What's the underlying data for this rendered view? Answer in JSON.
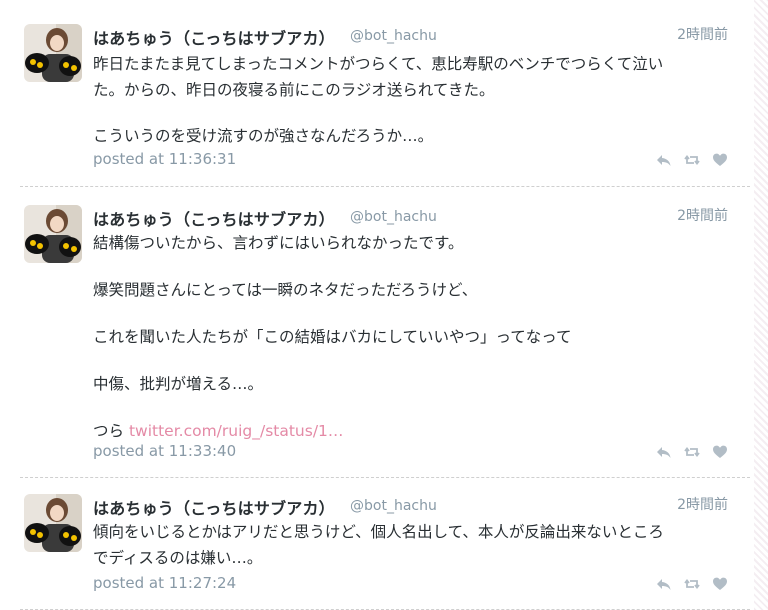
{
  "colors": {
    "text": "#292f33",
    "muted": "#8899a6",
    "link": "#e48aa6",
    "icon": "#b2bdc6"
  },
  "tweets": [
    {
      "display_name": "はあちゅう（こっちはサブアカ）",
      "screen_name": "@bot_hachu",
      "timestamp": "2時間前",
      "lines": [
        "昨日たまたま見てしまったコメントがつらくて、恵比寿駅のベンチでつらくて泣い",
        "た。からの、昨日の夜寝る前にこのラジオ送られてきた。",
        "",
        "こういうのを受け流すのが強さなんだろうか…。"
      ],
      "posted_at": "posted at 11:36:31",
      "actions": [
        "reply-icon",
        "retweet-icon",
        "like-icon"
      ]
    },
    {
      "display_name": "はあちゅう（こっちはサブアカ）",
      "screen_name": "@bot_hachu",
      "timestamp": "2時間前",
      "lines": [
        "結構傷ついたから、言わずにはいられなかったです。",
        "",
        "爆笑問題さんにとっては一瞬のネタだっただろうけど、",
        "",
        "これを聞いた人たちが「この結婚はバカにしていいやつ」ってなって",
        "",
        "中傷、批判が増える…。",
        ""
      ],
      "last_line_prefix": "つら ",
      "link_text": "twitter.com/ruig_/status/1…",
      "posted_at": "posted at 11:33:40",
      "actions": [
        "reply-icon",
        "retweet-icon",
        "like-icon"
      ]
    },
    {
      "display_name": "はあちゅう（こっちはサブアカ）",
      "screen_name": "@bot_hachu",
      "timestamp": "2時間前",
      "lines": [
        "傾向をいじるとかはアリだと思うけど、個人名出して、本人が反論出来ないところ",
        "でディスるのは嫌い…。"
      ],
      "posted_at": "posted at 11:27:24",
      "actions": [
        "reply-icon",
        "retweet-icon",
        "like-icon"
      ]
    }
  ]
}
